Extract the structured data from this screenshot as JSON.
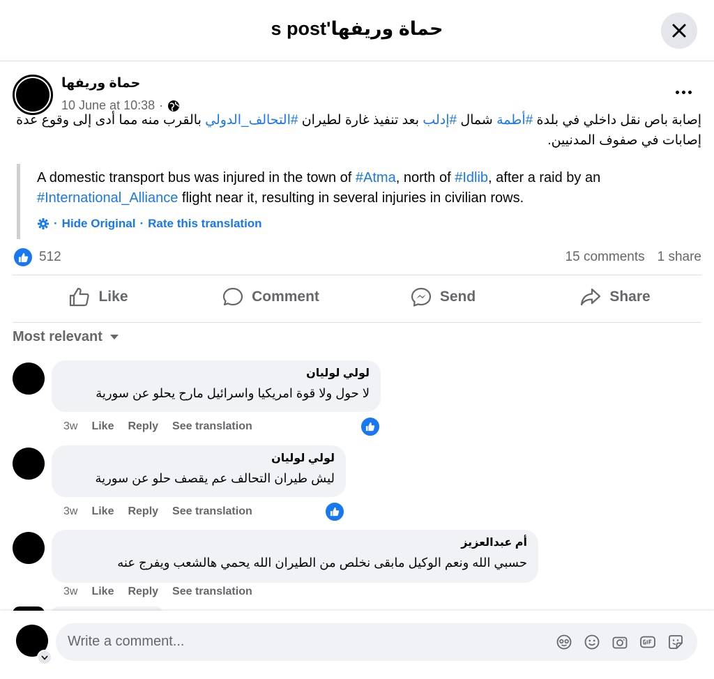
{
  "header": {
    "title": "حماة وريفها's post"
  },
  "post": {
    "author": "حماة وريفها",
    "date": "10 June at 10:38",
    "meta_dot": "·",
    "text_parts": [
      "إصابة باص نقل داخلي في بلدة ",
      "#أطمة",
      " شمال ",
      "#إدلب",
      " بعد تنفيذ غارة لطيران ",
      "#التحالف_الدولي",
      " بالقرب منه مما أدى إلى وقوع عدة إصابات في صفوف المدنيين."
    ],
    "translation_parts": [
      "A domestic transport bus was injured in the town of ",
      "#Atma",
      ", north of ",
      "#Idlib",
      ", after a raid by an ",
      "#International_Alliance",
      " flight near it, resulting in several injuries in civilian rows."
    ],
    "translation_sep1": "·",
    "hide_original": "Hide Original",
    "translation_sep2": "·",
    "rate_translation": "Rate this translation",
    "like_count": "512",
    "comments_count": "15 comments",
    "shares_count": "1 share"
  },
  "actions": {
    "like": "Like",
    "comment": "Comment",
    "send": "Send",
    "share": "Share"
  },
  "sort": {
    "label": "Most relevant"
  },
  "comments": [
    {
      "name": "لولي لوليان",
      "text": "لا حول ولا قوة امريكيا واسرائيل مارح يحلو عن سورية",
      "time": "3w",
      "like": "Like",
      "reply": "Reply",
      "translate": "See translation"
    },
    {
      "name": "لولي لوليان",
      "text": "ليش طيران التحالف عم يقصف حلو عن سورية",
      "time": "3w",
      "like": "Like",
      "reply": "Reply",
      "translate": "See translation"
    },
    {
      "name": "أم عبدالعزيز",
      "text": "حسبي الله ونعم الوكيل مابقى نخلص من الطيران الله يحمي هالشعب ويفرج عنه",
      "time": "3w",
      "like": "Like",
      "reply": "Reply",
      "translate": "See translation"
    }
  ],
  "composer": {
    "placeholder": "Write a comment..."
  },
  "colors": {
    "accent": "#1877f2",
    "muted": "#65676b",
    "bubble": "#f0f2f5",
    "divider": "#dcdfe3"
  },
  "icons": {
    "close": "close-icon",
    "more": "more-options-icon",
    "globe": "globe-icon",
    "settings": "gear-icon",
    "like": "thumbs-up-icon",
    "comment": "comment-bubble-icon",
    "send": "messenger-icon",
    "share": "share-arrow-icon",
    "sort": "caret-down-icon",
    "avatar_sticker": "avatar-sticker-icon",
    "emoji": "emoji-icon",
    "camera": "camera-icon",
    "gif": "gif-icon",
    "sticker": "sticker-icon"
  }
}
